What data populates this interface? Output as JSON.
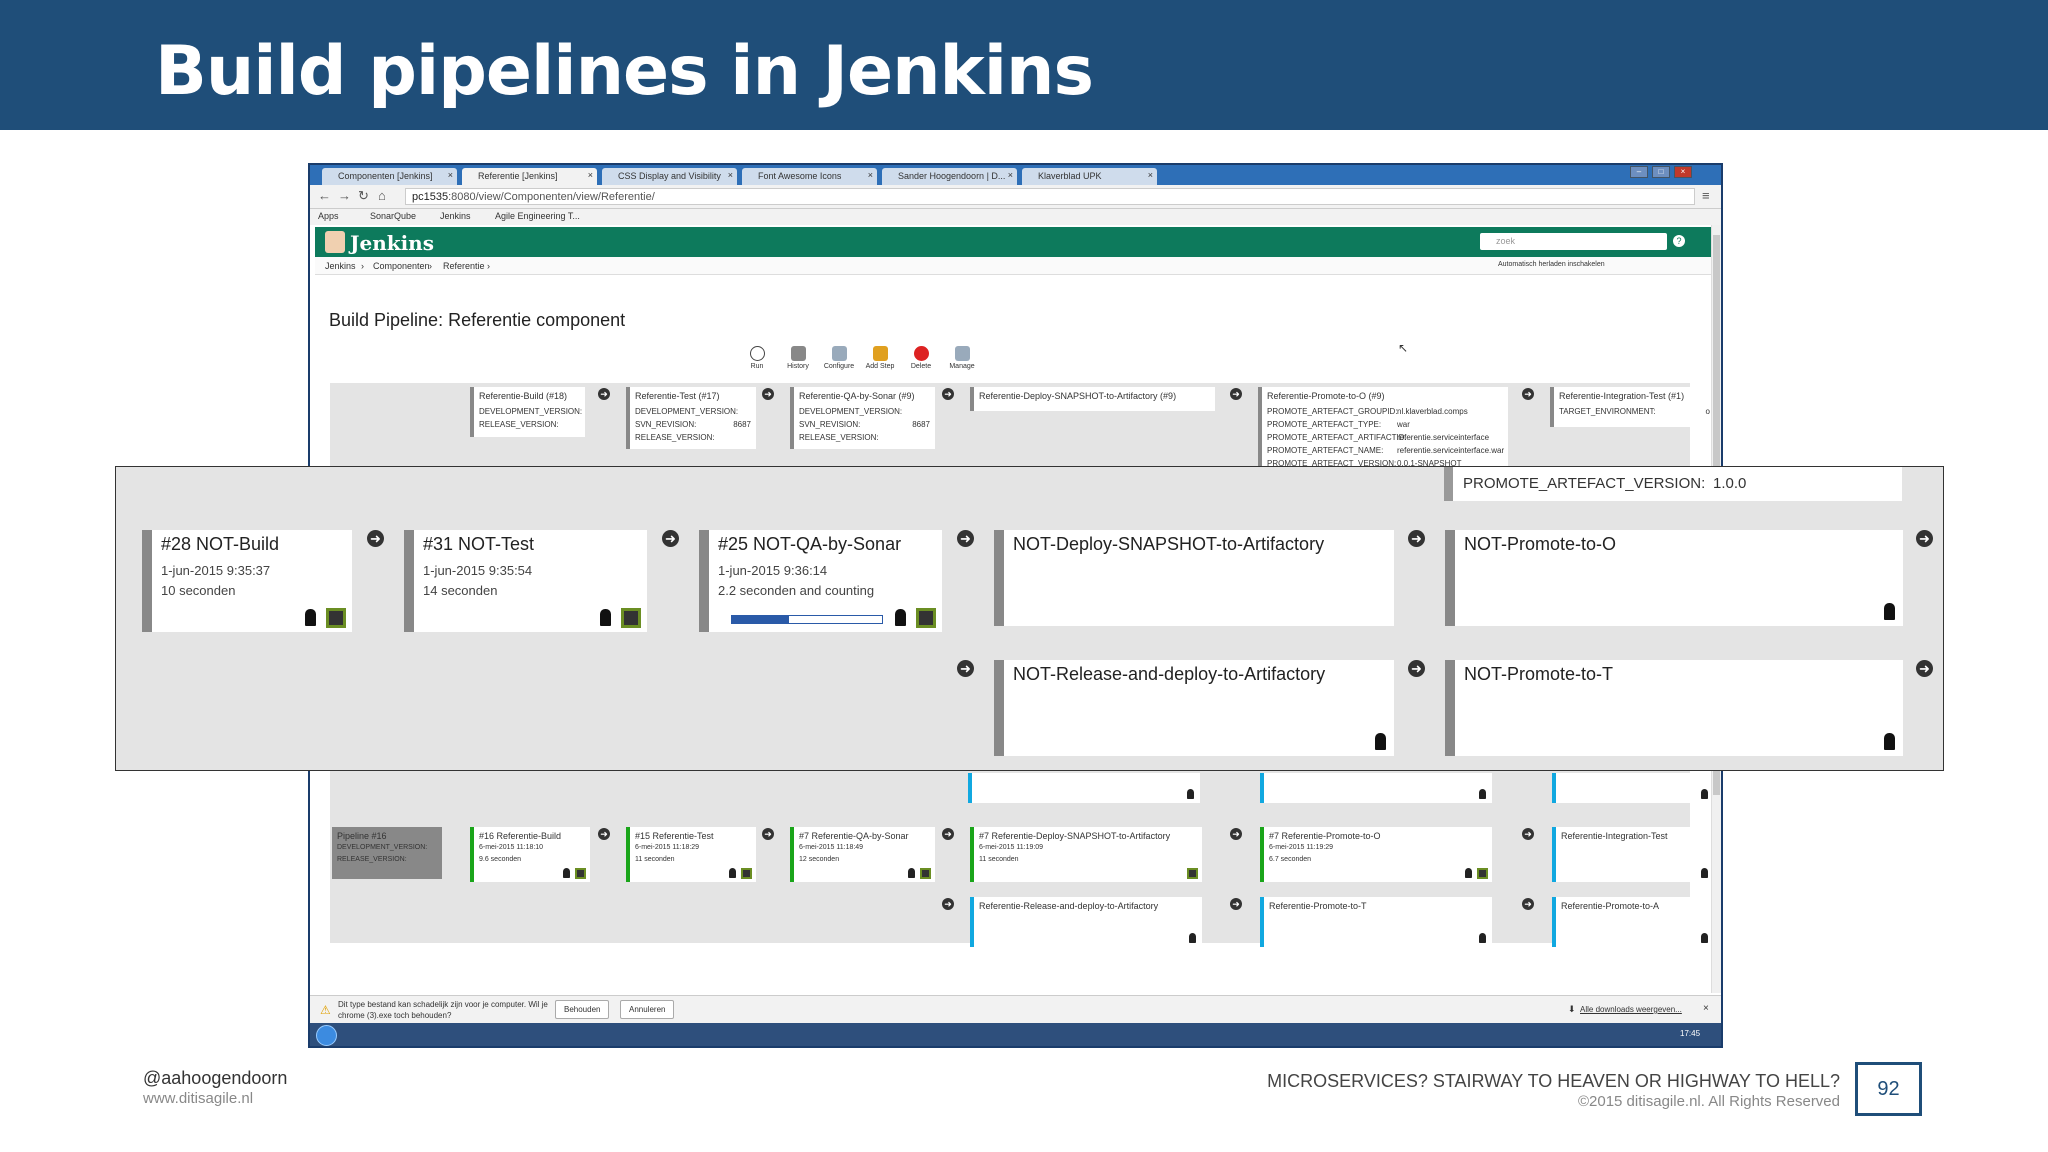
{
  "slide": {
    "title": "Build pipelines in Jenkins",
    "handle": "@aahoogendoorn",
    "site": "www.ditisagile.nl",
    "talk_title": "MICROSERVICES? STAIRWAY TO HEAVEN OR HIGHWAY TO HELL?",
    "copyright": "©2015 ditisagile.nl. All Rights Reserved",
    "page_number": "92"
  },
  "browser": {
    "tabs": [
      "Componenten [Jenkins]",
      "Referentie [Jenkins]",
      "CSS Display and Visibility",
      "Font Awesome Icons",
      "Sander Hoogendoorn | D...",
      "Klaverblad UPK"
    ],
    "active_tab": 1,
    "url_host": "pc1535",
    "url_rest": ":8080/view/Componenten/view/Referentie/",
    "bookmarks": [
      "Apps",
      "SonarQube",
      "Jenkins",
      "Agile Engineering T..."
    ]
  },
  "jenkins": {
    "logo": "Jenkins",
    "search_placeholder": "zoek",
    "breadcrumb": [
      "Jenkins",
      "Componenten",
      "Referentie"
    ],
    "auto_refresh": "Automatisch herladen inschakelen",
    "page_title": "Build Pipeline: Referentie component",
    "toolbar": [
      "Run",
      "History",
      "Configure",
      "Add Step",
      "Delete",
      "Manage"
    ],
    "header_jobs": [
      {
        "name": "Referentie-Build (#18)",
        "params": [
          "DEVELOPMENT_VERSION:",
          "RELEASE_VERSION:"
        ]
      },
      {
        "name": "Referentie-Test (#17)",
        "params": [
          "DEVELOPMENT_VERSION:",
          "SVN_REVISION:",
          "RELEASE_VERSION:"
        ],
        "values": [
          "",
          "8687",
          ""
        ]
      },
      {
        "name": "Referentie-QA-by-Sonar (#9)",
        "params": [
          "DEVELOPMENT_VERSION:",
          "SVN_REVISION:",
          "RELEASE_VERSION:"
        ],
        "values": [
          "",
          "8687",
          ""
        ]
      },
      {
        "name": "Referentie-Deploy-SNAPSHOT-to-Artifactory (#9)",
        "params": []
      },
      {
        "name": "Referentie-Promote-to-O (#9)",
        "params": [
          "PROMOTE_ARTEFACT_GROUPID:",
          "PROMOTE_ARTEFACT_TYPE:",
          "PROMOTE_ARTEFACT_ARTIFACTID:",
          "PROMOTE_ARTEFACT_NAME:",
          "PROMOTE_ARTEFACT_VERSION:"
        ],
        "values": [
          "nl.klaverblad.comps",
          "war",
          "referentie.serviceinterface",
          "referentie.serviceinterface.war",
          "0.0.1-SNAPSHOT"
        ]
      },
      {
        "name": "Referentie-Integration-Test (#1)",
        "params": [
          "TARGET_ENVIRONMENT:"
        ],
        "values": [
          "o"
        ]
      }
    ],
    "pipeline16": {
      "label": "Pipeline #16",
      "params": [
        "DEVELOPMENT_VERSION:",
        "RELEASE_VERSION:"
      ],
      "jobs": [
        {
          "name": "#16 Referentie-Build",
          "date": "6-mei-2015 11:18:10",
          "duration": "9.6 seconden"
        },
        {
          "name": "#15 Referentie-Test",
          "date": "6-mei-2015 11:18:29",
          "duration": "11 seconden"
        },
        {
          "name": "#7 Referentie-QA-by-Sonar",
          "date": "6-mei-2015 11:18:49",
          "duration": "12 seconden"
        },
        {
          "name": "#7 Referentie-Deploy-SNAPSHOT-to-Artifactory",
          "date": "6-mei-2015 11:19:09",
          "duration": "11 seconden"
        },
        {
          "name": "#7 Referentie-Promote-to-O",
          "date": "6-mei-2015 11:19:29",
          "duration": "6.7 seconden"
        },
        {
          "name": "Referentie-Integration-Test",
          "date": "",
          "duration": ""
        }
      ],
      "second_row": [
        "Referentie-Release-and-deploy-to-Artifactory",
        "Referentie-Promote-to-T",
        "Referentie-Promote-to-A"
      ]
    },
    "download_warning": "Dit type bestand kan schadelijk zijn voor je computer. Wil je chrome (3).exe toch behouden?",
    "keep_button": "Behouden",
    "cancel_button": "Annuleren",
    "all_downloads": "Alle downloads weergeven...",
    "clock": "17:45"
  },
  "overlay": {
    "promote_label": "PROMOTE_ARTEFACT_VERSION:",
    "promote_value": "1.0.0",
    "cards": [
      {
        "title": "#28 NOT-Build",
        "date": "1-jun-2015 9:35:37",
        "duration": "10 seconden",
        "status": "success"
      },
      {
        "title": "#31 NOT-Test",
        "date": "1-jun-2015 9:35:54",
        "duration": "14 seconden",
        "status": "success"
      },
      {
        "title": "#25 NOT-QA-by-Sonar",
        "date": "1-jun-2015 9:36:14",
        "duration": "2.2 seconden and counting",
        "status": "running",
        "progress": 0.38
      },
      {
        "title": "NOT-Deploy-SNAPSHOT-to-Artifactory",
        "status": "pending"
      },
      {
        "title": "NOT-Promote-to-O",
        "status": "pending"
      },
      {
        "title": "NOT-Release-and-deploy-to-Artifactory",
        "status": "pending"
      },
      {
        "title": "NOT-Promote-to-T",
        "status": "pending"
      }
    ]
  },
  "colors": {
    "header": "#1f4e79",
    "jenkins_green": "#0d7a5c",
    "success": "#1aa51a",
    "pending": "#11a8e0",
    "running": "#f3e10f"
  }
}
